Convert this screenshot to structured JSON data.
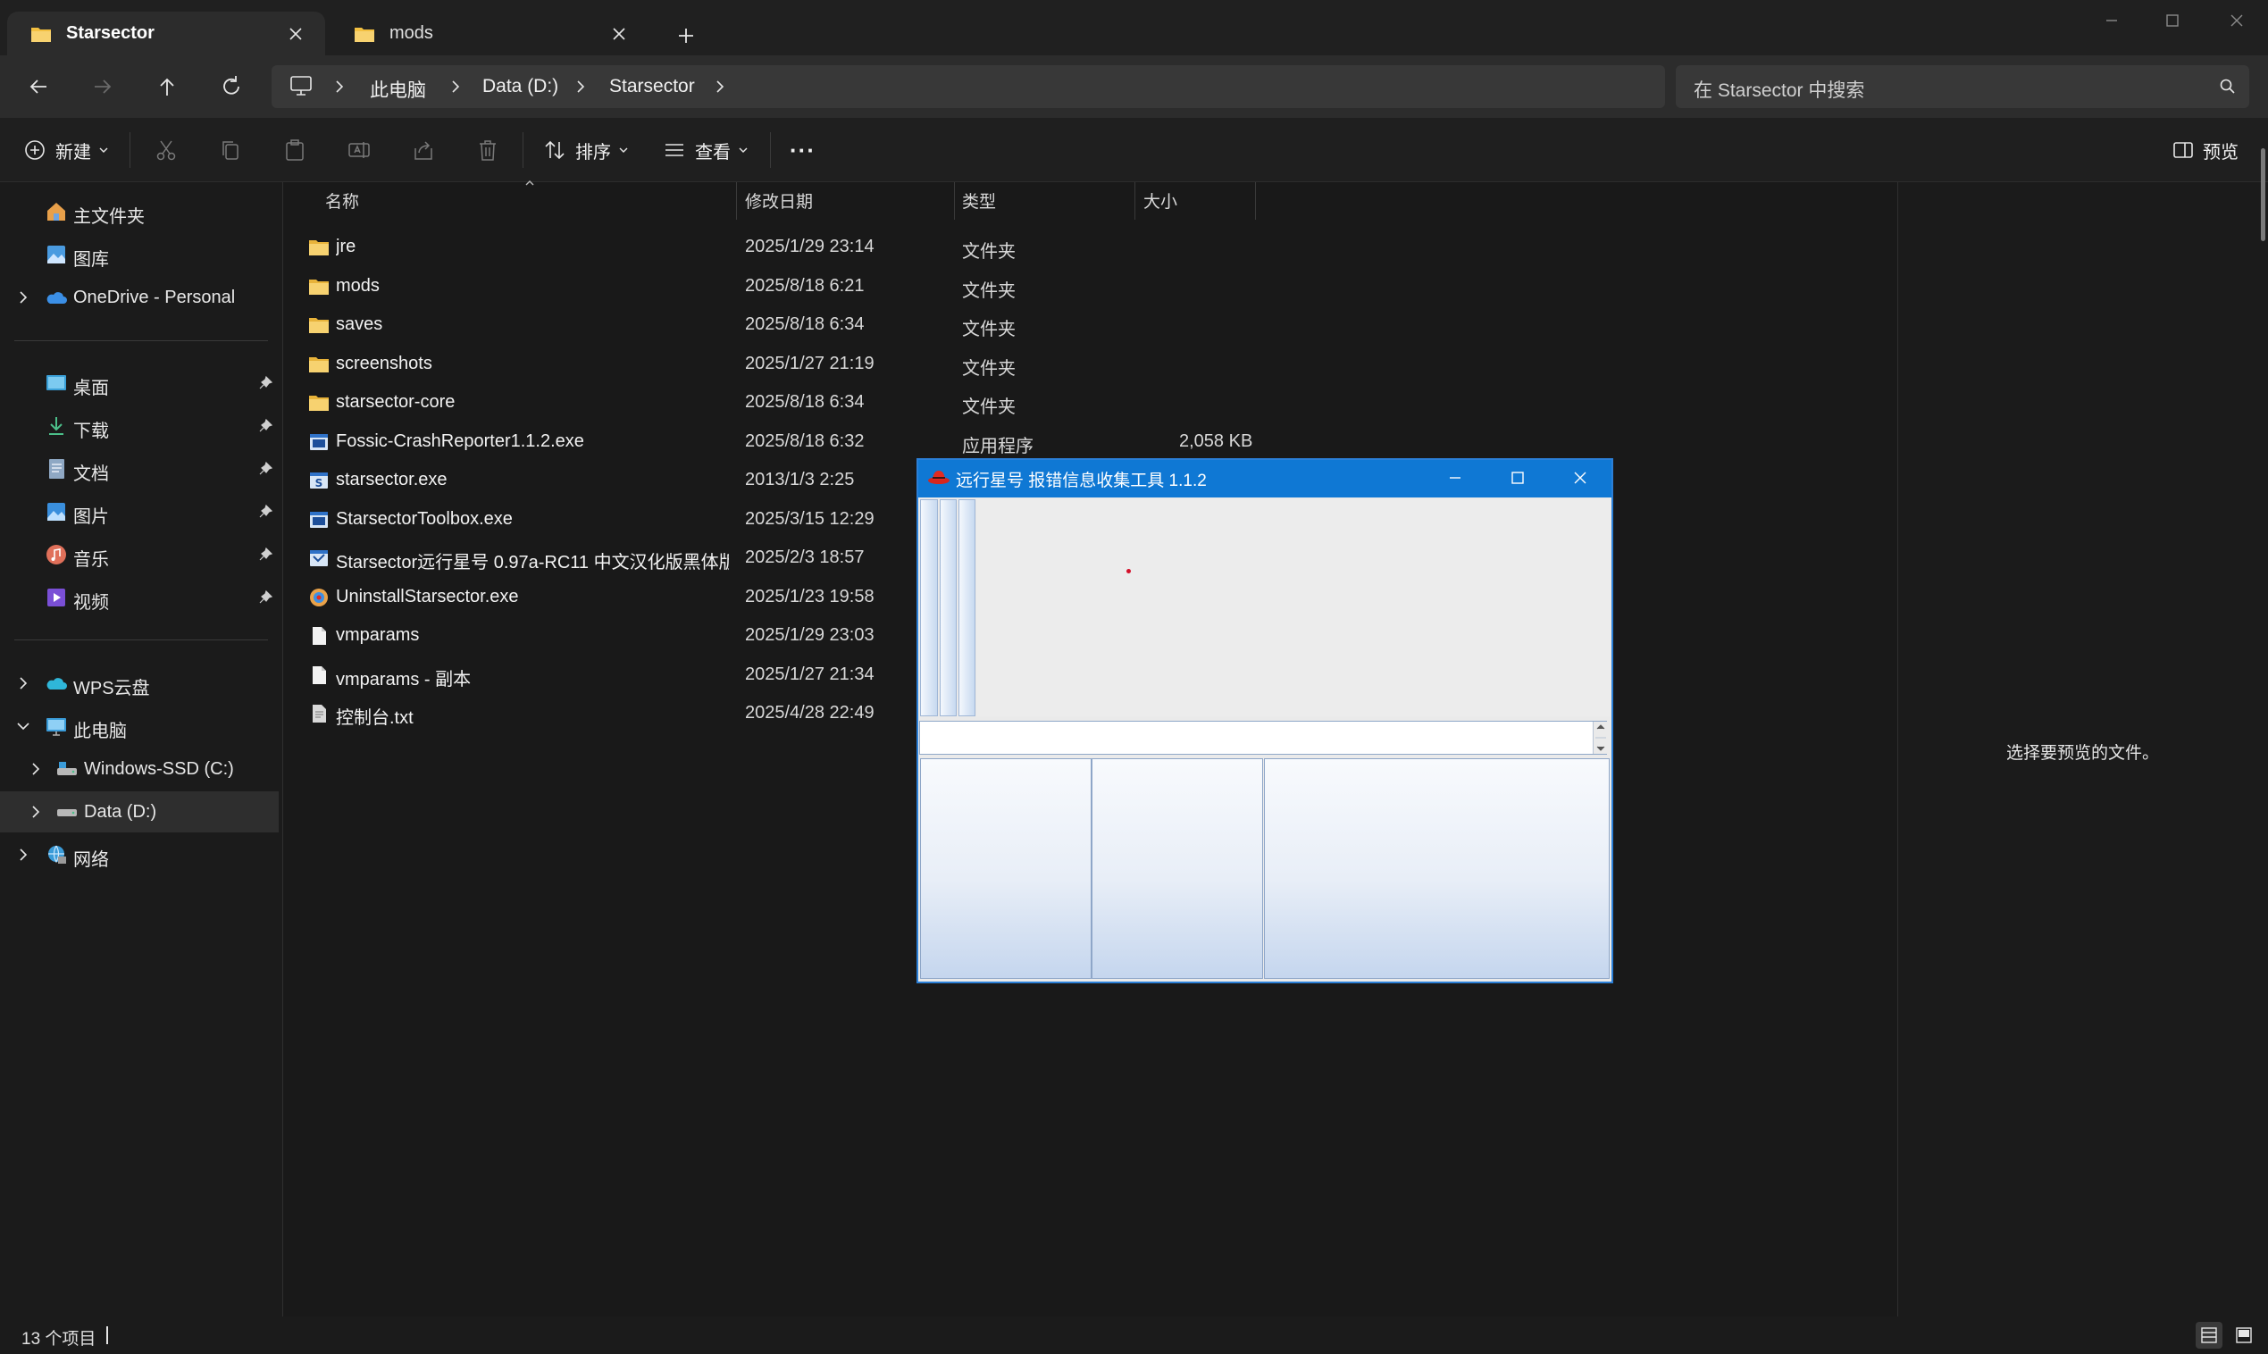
{
  "tabs": [
    {
      "label": "Starsector",
      "icon": "folder-icon",
      "active": true
    },
    {
      "label": "mods",
      "icon": "folder-icon",
      "active": false
    }
  ],
  "newtab_glyph": "+",
  "address": {
    "crumbs": [
      "此电脑",
      "Data (D:)",
      "Starsector"
    ],
    "search_placeholder": "在 Starsector 中搜索"
  },
  "toolbar": {
    "new_label": "新建",
    "sort_label": "排序",
    "view_label": "查看",
    "more_glyph": "···",
    "preview_label": "预览"
  },
  "sidebar": {
    "quick": [
      {
        "label": "主文件夹",
        "icon": "home-icon"
      },
      {
        "label": "图库",
        "icon": "gallery-icon"
      },
      {
        "label": "OneDrive - Personal",
        "icon": "cloud-icon",
        "expandable": true
      }
    ],
    "pinned": [
      {
        "label": "桌面",
        "icon": "desktop-icon"
      },
      {
        "label": "下载",
        "icon": "download-icon"
      },
      {
        "label": "文档",
        "icon": "document-icon"
      },
      {
        "label": "图片",
        "icon": "pictures-icon"
      },
      {
        "label": "音乐",
        "icon": "music-icon"
      },
      {
        "label": "视频",
        "icon": "video-icon"
      }
    ],
    "tree": [
      {
        "label": "WPS云盘",
        "icon": "wps-cloud-icon"
      },
      {
        "label": "此电脑",
        "icon": "computer-icon",
        "expanded": true
      },
      {
        "label": "Windows-SSD (C:)",
        "icon": "drive-icon"
      },
      {
        "label": "Data (D:)",
        "icon": "drive-icon",
        "selected": true
      },
      {
        "label": "网络",
        "icon": "network-icon"
      }
    ]
  },
  "columns": {
    "name": "名称",
    "date": "修改日期",
    "type": "类型",
    "size": "大小"
  },
  "files": [
    {
      "name": "jre",
      "date": "2025/1/29 23:14",
      "type": "文件夹",
      "size": "",
      "icon": "folder-icon"
    },
    {
      "name": "mods",
      "date": "2025/8/18 6:21",
      "type": "文件夹",
      "size": "",
      "icon": "folder-icon"
    },
    {
      "name": "saves",
      "date": "2025/8/18 6:34",
      "type": "文件夹",
      "size": "",
      "icon": "folder-icon"
    },
    {
      "name": "screenshots",
      "date": "2025/1/27 21:19",
      "type": "文件夹",
      "size": "",
      "icon": "folder-icon"
    },
    {
      "name": "starsector-core",
      "date": "2025/8/18 6:34",
      "type": "文件夹",
      "size": "",
      "icon": "folder-icon"
    },
    {
      "name": "Fossic-CrashReporter1.1.2.exe",
      "date": "2025/8/18 6:32",
      "type": "应用程序",
      "size": "2,058 KB",
      "icon": "exe-icon"
    },
    {
      "name": "starsector.exe",
      "date": "2013/1/3 2:25",
      "type": "",
      "size": "",
      "icon": "starsector-exe-icon"
    },
    {
      "name": "StarsectorToolbox.exe",
      "date": "2025/3/15 12:29",
      "type": "",
      "size": "",
      "icon": "exe-icon"
    },
    {
      "name": "Starsector远行星号 0.97a-RC11 中文汉化版黑体版 ...",
      "date": "2025/2/3 18:57",
      "type": "",
      "size": "",
      "icon": "installer-icon"
    },
    {
      "name": "UninstallStarsector.exe",
      "date": "2025/1/23 19:58",
      "type": "",
      "size": "",
      "icon": "uninstall-icon"
    },
    {
      "name": "vmparams",
      "date": "2025/1/29 23:03",
      "type": "",
      "size": "",
      "icon": "file-icon"
    },
    {
      "name": "vmparams - 副本",
      "date": "2025/1/27 21:34",
      "type": "",
      "size": "",
      "icon": "file-icon"
    },
    {
      "name": "控制台.txt",
      "date": "2025/4/28 22:49",
      "type": "",
      "size": "",
      "icon": "text-file-icon"
    }
  ],
  "preview_pane": {
    "message": "选择要预览的文件。"
  },
  "status": {
    "count": "13 个项目"
  },
  "dialog": {
    "title": "远行星号 报错信息收集工具 1.1.2",
    "icon": "redhat-icon"
  },
  "colors": {
    "accent": "#0f78d4",
    "folder": "#f3c041",
    "background": "#191919"
  }
}
